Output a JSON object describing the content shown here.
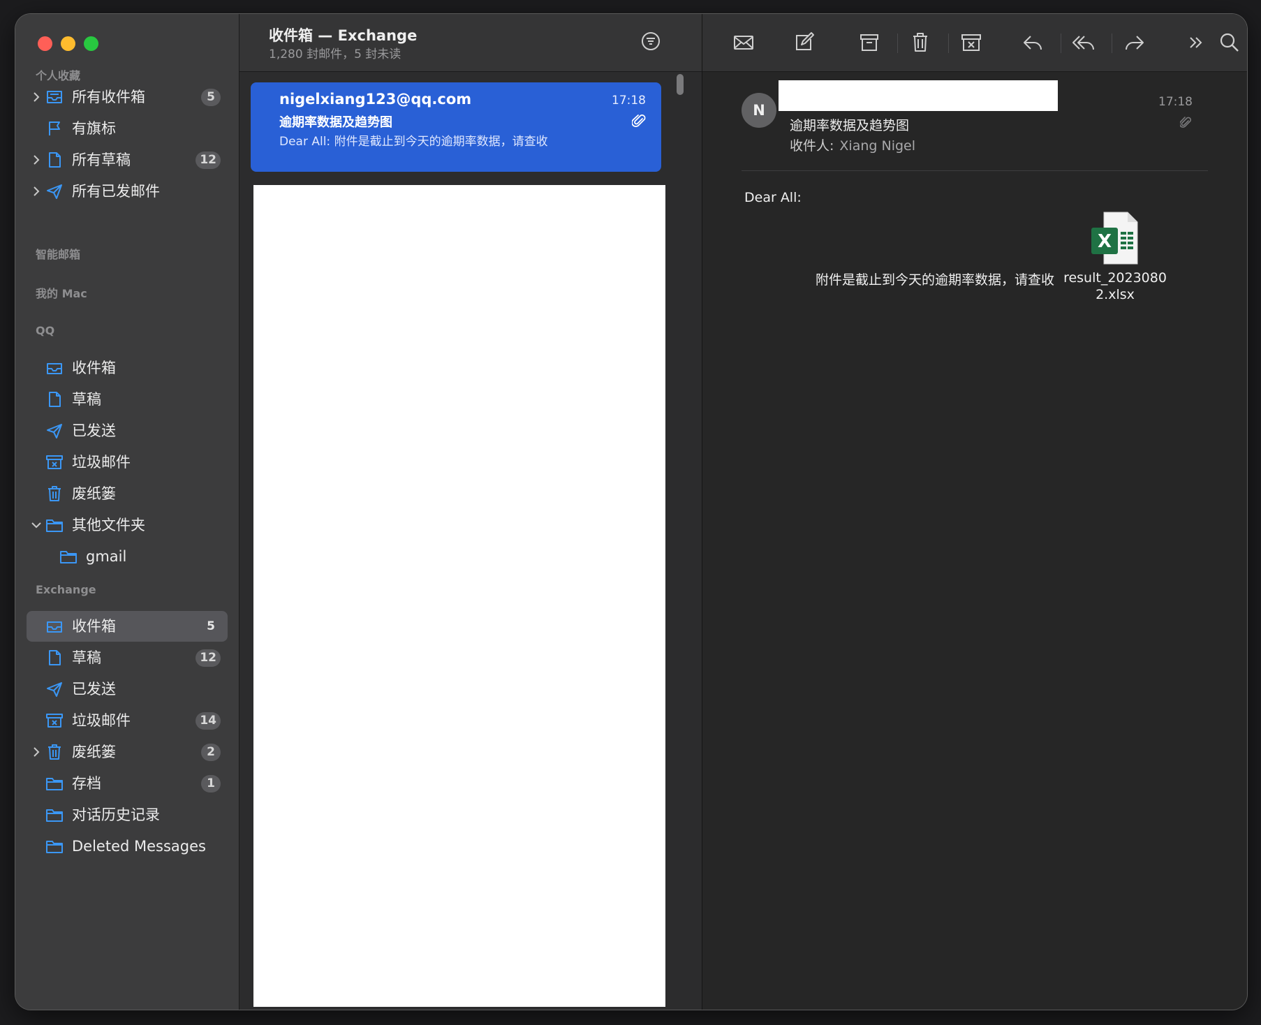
{
  "sidebar": {
    "sections": [
      {
        "label": "个人收藏"
      },
      {
        "label": "智能邮箱"
      },
      {
        "label": "我的 Mac"
      },
      {
        "label": "QQ"
      },
      {
        "label": "Exchange"
      }
    ],
    "favorites": [
      {
        "label": "所有收件箱",
        "badge": "5",
        "icon": "inbox-icon"
      },
      {
        "label": "有旗标",
        "icon": "flag-icon"
      },
      {
        "label": "所有草稿",
        "badge": "12",
        "icon": "document-icon"
      },
      {
        "label": "所有已发邮件",
        "icon": "paperplane-icon"
      }
    ],
    "qq": [
      {
        "label": "收件箱",
        "icon": "inbox-icon"
      },
      {
        "label": "草稿",
        "icon": "document-icon"
      },
      {
        "label": "已发送",
        "icon": "paperplane-icon"
      },
      {
        "label": "垃圾邮件",
        "icon": "junk-icon"
      },
      {
        "label": "废纸篓",
        "icon": "trash-icon"
      },
      {
        "label": "其他文件夹",
        "icon": "folder-icon"
      },
      {
        "label": "gmail",
        "icon": "folder-icon"
      }
    ],
    "exchange": [
      {
        "label": "收件箱",
        "badge": "5",
        "icon": "inbox-icon"
      },
      {
        "label": "草稿",
        "badge": "12",
        "icon": "document-icon"
      },
      {
        "label": "已发送",
        "icon": "paperplane-icon"
      },
      {
        "label": "垃圾邮件",
        "badge": "14",
        "icon": "junk-icon"
      },
      {
        "label": "废纸篓",
        "badge": "2",
        "icon": "trash-icon"
      },
      {
        "label": "存档",
        "badge": "1",
        "icon": "folder-icon"
      },
      {
        "label": "对话历史记录",
        "icon": "folder-icon"
      },
      {
        "label": "Deleted Messages",
        "icon": "folder-icon"
      }
    ]
  },
  "list": {
    "title": "收件箱 — Exchange",
    "subtitle": "1,280 封邮件，5 封未读",
    "messages": [
      {
        "from": "nigelxiang123@qq.com",
        "time": "17:18",
        "subject": "逾期率数据及趋势图",
        "preview": "Dear All: 附件是截止到今天的逾期率数据，请查收"
      }
    ]
  },
  "reader": {
    "avatar_initial": "N",
    "time": "17:18",
    "subject": "逾期率数据及趋势图",
    "to_label": "收件人:",
    "to_name": "Xiang Nigel",
    "greeting": "Dear All:",
    "body": "附件是截止到今天的逾期率数据，请查收",
    "attachment_name": "result_20230802.xlsx",
    "attachment_line1": "result_2023080",
    "attachment_line2": "2.xlsx",
    "xls_letter": "X"
  },
  "colors": {
    "accent": "#2960d6",
    "icon_blue": "#3b97f5",
    "sidebar_bg": "#3c3c3d",
    "excel_green": "#1f7244"
  }
}
